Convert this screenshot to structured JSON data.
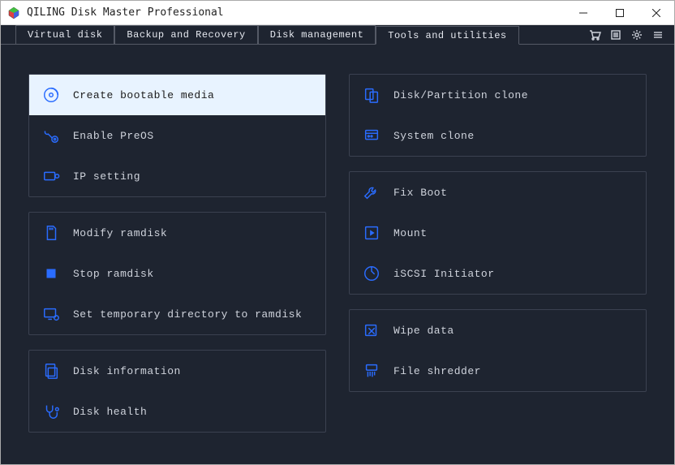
{
  "app": {
    "title": "QILING Disk Master Professional"
  },
  "tabs": {
    "virtual_disk": "Virtual disk",
    "backup_recovery": "Backup and Recovery",
    "disk_management": "Disk management",
    "tools_utilities": "Tools and utilities"
  },
  "tools": {
    "group1": {
      "create_bootable_media": "Create bootable media",
      "enable_preos": "Enable PreOS",
      "ip_setting": "IP setting"
    },
    "group2": {
      "modify_ramdisk": "Modify ramdisk",
      "stop_ramdisk": "Stop ramdisk",
      "set_temp_ramdisk": "Set temporary directory to ramdisk"
    },
    "group3": {
      "disk_information": "Disk information",
      "disk_health": "Disk health"
    },
    "group4": {
      "disk_partition_clone": "Disk/Partition clone",
      "system_clone": "System clone"
    },
    "group5": {
      "fix_boot": "Fix Boot",
      "mount": "Mount",
      "iscsi_initiator": "iSCSI Initiator"
    },
    "group6": {
      "wipe_data": "Wipe data",
      "file_shredder": "File shredder"
    }
  }
}
